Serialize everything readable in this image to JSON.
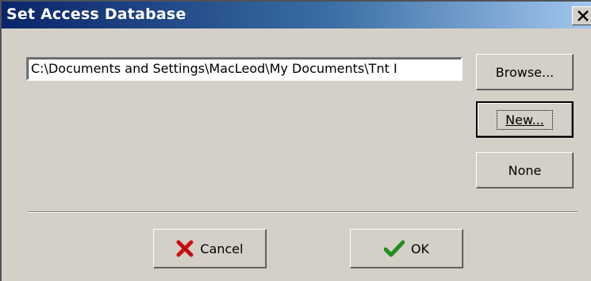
{
  "window": {
    "title": "Set Access Database"
  },
  "path_field": {
    "value": "C:\\Documents and Settings\\MacLeod\\My Documents\\Tnt I"
  },
  "buttons": {
    "browse_label": "Browse...",
    "new_label": "New...",
    "none_label": "None",
    "cancel_label": "Cancel",
    "ok_label": "OK"
  },
  "icons": {
    "close": "close-icon",
    "cancel": "red-x-icon",
    "ok": "green-check-icon"
  },
  "colors": {
    "title_bar_start": "#0a246a",
    "title_bar_end": "#a6caf0",
    "dialog_face": "#d4d0c8",
    "cancel_icon": "#cc1010",
    "ok_icon": "#1f8f1f"
  }
}
